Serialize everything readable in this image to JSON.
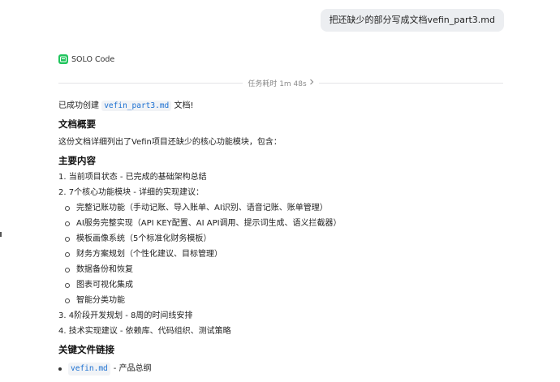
{
  "user_message": "把还缺少的部分写成文档vefin_part3.md",
  "agent": {
    "name": "SOLO Code",
    "timer_label": "任务耗时 1m 48s"
  },
  "response": {
    "intro_prefix": "已成功创建",
    "intro_file": "vefin_part3.md",
    "intro_suffix": "文档!",
    "overview_heading": "文档概要",
    "overview_text": "这份文档详细列出了Vefin项目还缺少的核心功能模块，包含：",
    "main_heading": "主要内容",
    "main_items": [
      "1. 当前项目状态 - 已完成的基础架构总结",
      "2. 7个核心功能模块 - 详细的实现建议：",
      "3. 4阶段开发规划 - 8周的时间线安排",
      "4. 技术实现建议 - 依赖库、代码组织、测试策略"
    ],
    "modules": [
      "完整记账功能（手动记账、导入账单、AI识别、语音记账、账单管理）",
      "AI服务完整实现（API KEY配置、AI API调用、提示词生成、语义拦截器）",
      "模板画像系统（5个标准化财务模板）",
      "财务方案规划（个性化建议、目标管理）",
      "数据备份和恢复",
      "图表可视化集成",
      "智能分类功能"
    ],
    "files_heading": "关键文件链接",
    "files": [
      {
        "name": "vefin.md",
        "desc": "- 产品总纲"
      }
    ]
  },
  "colors": {
    "accent_code": "#1a6fd1",
    "logo_green": "#22c55e",
    "bubble_bg": "#eceef1"
  }
}
